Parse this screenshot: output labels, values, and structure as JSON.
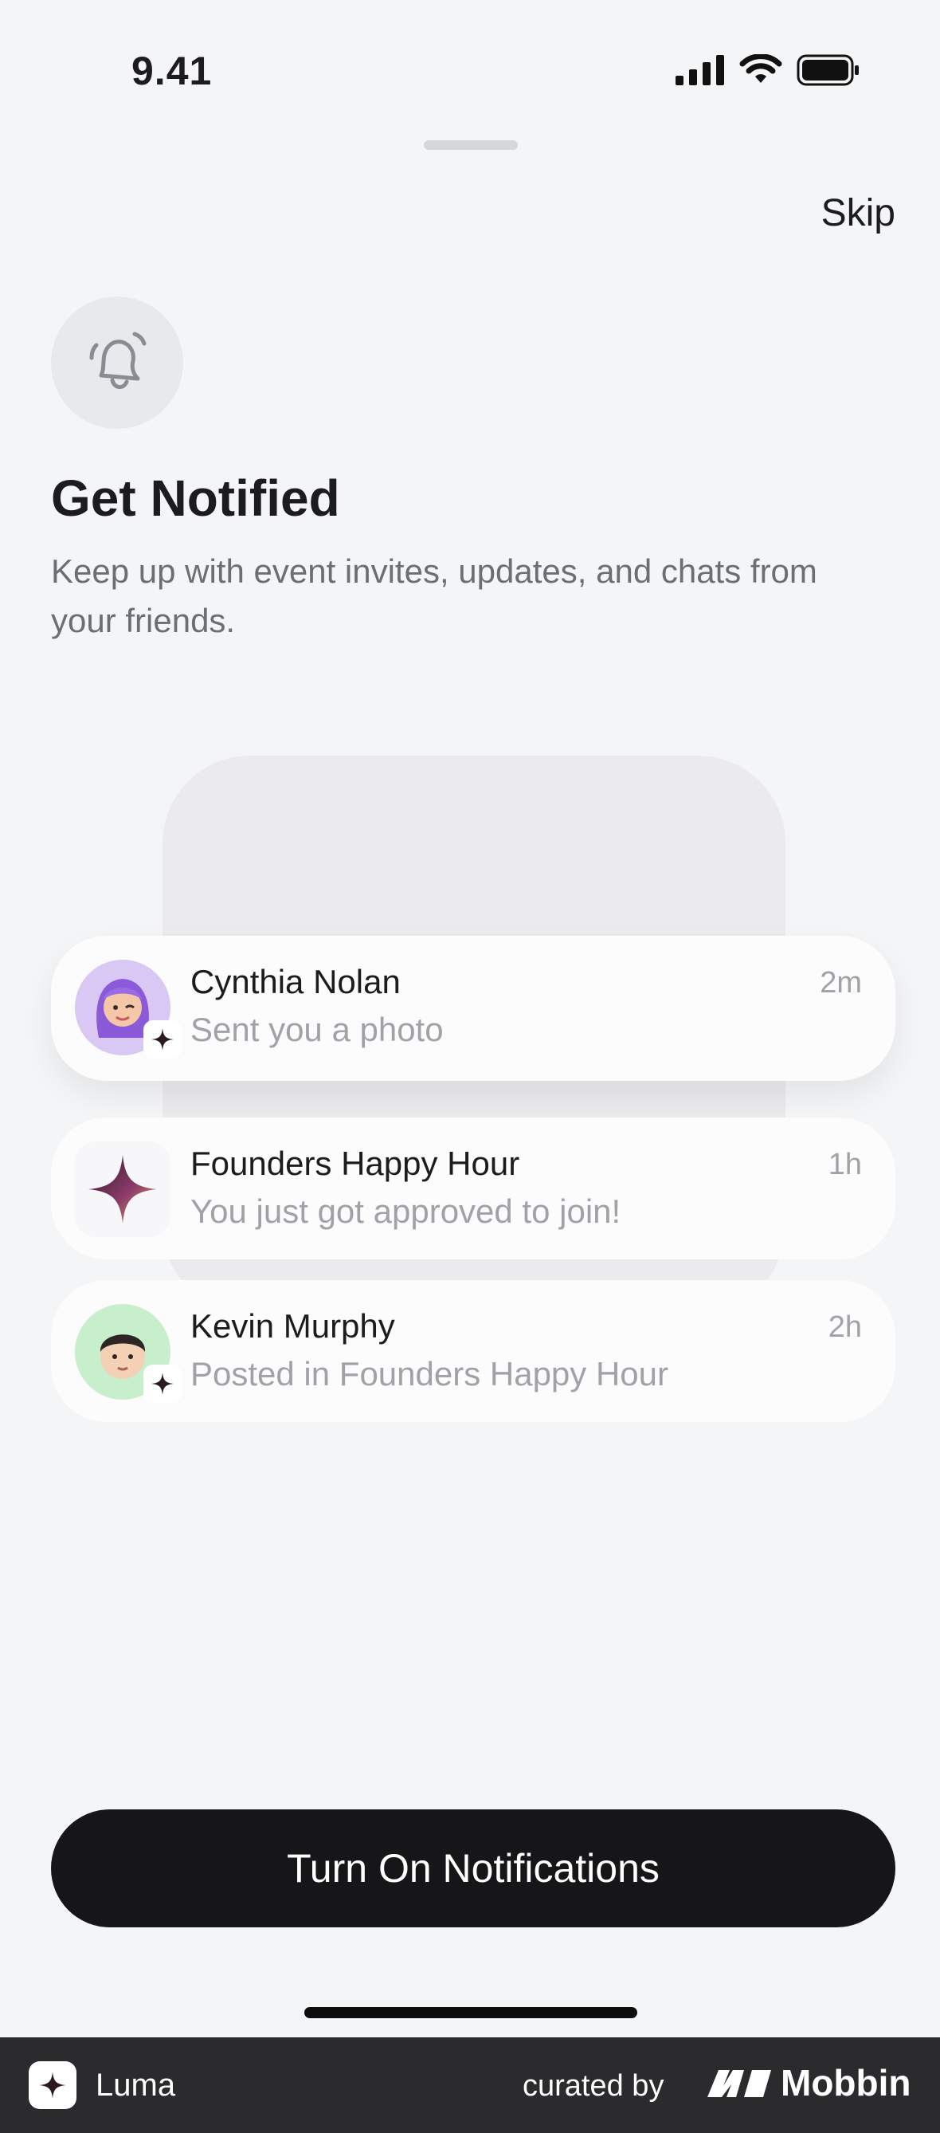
{
  "status_bar": {
    "time": "9.41",
    "icons": [
      "signal-icon",
      "wifi-icon",
      "battery-icon"
    ]
  },
  "header": {
    "skip_label": "Skip"
  },
  "hero": {
    "icon": "bell-icon",
    "title": "Get Notified",
    "subtitle": "Keep up with event invites, updates, and chats from your friends."
  },
  "notifications": [
    {
      "name": "Cynthia Nolan",
      "message": "Sent you a photo",
      "time": "2m",
      "avatar": "memoji-purple-hair-avatar"
    },
    {
      "name": "Founders Happy Hour",
      "message": "You just got approved to join!",
      "time": "1h",
      "avatar": "sparkle-icon"
    },
    {
      "name": "Kevin Murphy",
      "message": "Posted in Founders Happy Hour",
      "time": "2h",
      "avatar": "memoji-dark-hair-avatar"
    }
  ],
  "cta": {
    "label": "Turn On Notifications"
  },
  "footer": {
    "app_name": "Luma",
    "curated_by": "curated by",
    "brand": "Mobbin"
  },
  "colors": {
    "background": "#f4f5f7",
    "button": "#161618",
    "footer": "#2b2b2d"
  }
}
